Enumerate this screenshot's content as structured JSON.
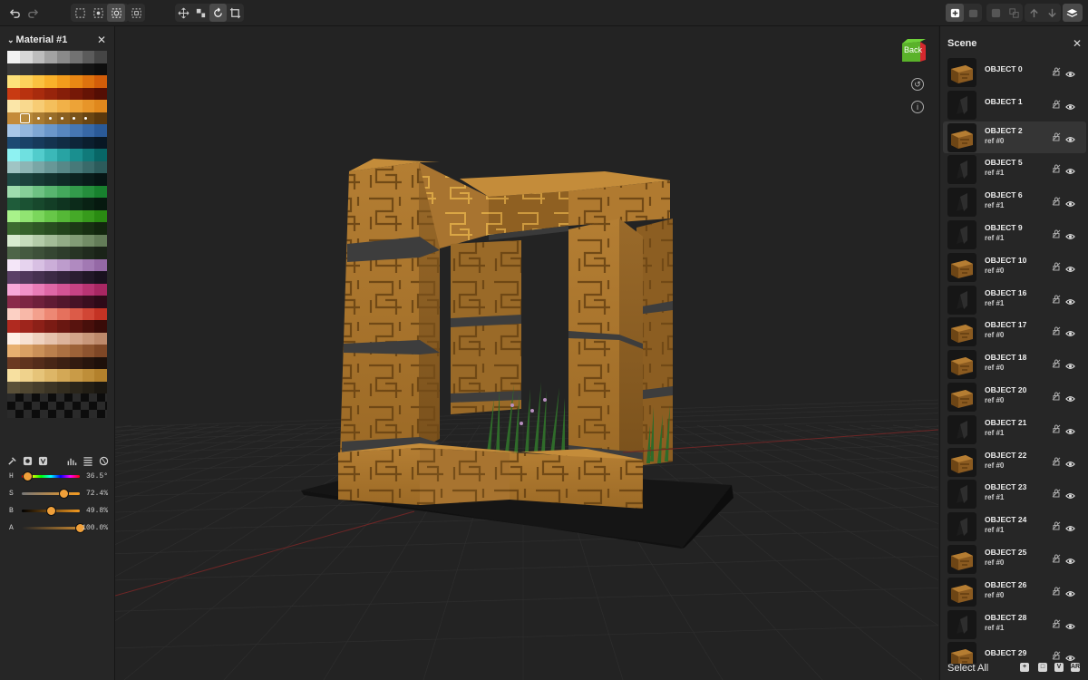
{
  "material_panel": {
    "title": "Material #1",
    "sliders": [
      {
        "label": "H",
        "value_text": "36.5°",
        "fraction": 0.1
      },
      {
        "label": "S",
        "value_text": "72.4%",
        "fraction": 0.724
      },
      {
        "label": "B",
        "value_text": "49.8%",
        "fraction": 0.498
      },
      {
        "label": "A",
        "value_text": "100.0%",
        "fraction": 1.0
      }
    ],
    "palette_rows": [
      [
        "#f2f2f2",
        "#d8d8d8",
        "#bdbdbd",
        "#a3a3a3",
        "#8a8a8a",
        "#727272",
        "#5b5b5b",
        "#454545"
      ],
      [
        "#3a3a3a",
        "#333333",
        "#2c2c2c",
        "#262626",
        "#202020",
        "#1a1a1a",
        "#141414",
        "#0e0e0e"
      ],
      [
        "#fde27a",
        "#fcd25c",
        "#fbc240",
        "#f9b12a",
        "#f39c1c",
        "#e98714",
        "#de720e",
        "#d25d09"
      ],
      [
        "#c83a12",
        "#b8320f",
        "#a82b0d",
        "#97240b",
        "#861e09",
        "#761807",
        "#651305",
        "#540e04"
      ],
      [
        "#fbe6a8",
        "#f9d98e",
        "#f7cc74",
        "#f4bf5c",
        "#f1b148",
        "#eda337",
        "#e79529",
        "#e0881d"
      ],
      [
        "sel",
        "#b88a3c",
        "#a97b32",
        "#996d29",
        "#895f21",
        "#79521a",
        "#694513",
        "#5a380d"
      ],
      [
        "#a8c7e8",
        "#93b7de",
        "#7ea7d4",
        "#6a97ca",
        "#5787bf",
        "#4677b3",
        "#3768a6",
        "#2a5a98"
      ],
      [
        "#1d4a73",
        "#1a4267",
        "#173a5b",
        "#14334f",
        "#112c44",
        "#0e2539",
        "#0b1e2e",
        "#081724"
      ],
      [
        "#8ef2f2",
        "#6fe0e0",
        "#52cccc",
        "#3bb8b8",
        "#28a3a3",
        "#1a8f8f",
        "#107a7a",
        "#086666"
      ],
      [
        "#a0c4c4",
        "#8db5b5",
        "#7aa6a6",
        "#689797",
        "#578888",
        "#477979",
        "#396a6a",
        "#2c5b5b"
      ],
      [
        "#1f4a45",
        "#1b423d",
        "#173a35",
        "#13322e",
        "#0f2a27",
        "#0c2320",
        "#091c1a",
        "#061514"
      ],
      [
        "#9fdcae",
        "#86cf98",
        "#6ec283",
        "#58b56f",
        "#44a85c",
        "#339b4b",
        "#258e3c",
        "#18812e"
      ],
      [
        "#1f5c3a",
        "#1b5233",
        "#17482c",
        "#133e26",
        "#0f3420",
        "#0c2b1a",
        "#092214",
        "#06190f"
      ],
      [
        "#a8f28a",
        "#91e472",
        "#7bd65c",
        "#67c748",
        "#55b837",
        "#45a928",
        "#379a1c",
        "#2a8b12"
      ],
      [
        "#3c6b30",
        "#35612a",
        "#2e5725",
        "#284d20",
        "#22431b",
        "#1c3916",
        "#172f12",
        "#12260e"
      ],
      [
        "#d8ecd0",
        "#c6dcbc",
        "#b4cca9",
        "#a3bc97",
        "#92ac86",
        "#829c76",
        "#728c66",
        "#637c58"
      ],
      [
        "#4d6548",
        "#455a40",
        "#3d5039",
        "#354632",
        "#2e3d2b",
        "#273424",
        "#202b1e",
        "#1a2318"
      ],
      [
        "#f4e6f8",
        "#e6d3ee",
        "#d8c0e3",
        "#cbaed8",
        "#bd9ccc",
        "#b08ac0",
        "#a279b3",
        "#9569a6"
      ],
      [
        "#5a3f66",
        "#50385b",
        "#463150",
        "#3c2a45",
        "#33233b",
        "#2a1d31",
        "#211727",
        "#19111e"
      ],
      [
        "#f7a8d8",
        "#f092c8",
        "#e87cb7",
        "#de67a6",
        "#d35495",
        "#c64384",
        "#b83473",
        "#a82763"
      ],
      [
        "#8a2a4a",
        "#7c2543",
        "#6e203b",
        "#601b34",
        "#53172d",
        "#461226",
        "#3a0e1f",
        "#2e0a18"
      ],
      [
        "#fcd0c4",
        "#f8b8a8",
        "#f3a08d",
        "#ed8874",
        "#e5715d",
        "#dc5b48",
        "#d14635",
        "#c43324"
      ],
      [
        "#b02a20",
        "#9e251c",
        "#8c2018",
        "#7a1b14",
        "#691711",
        "#58130e",
        "#480f0b",
        "#390b08"
      ],
      [
        "#fff0e6",
        "#f7e1d2",
        "#efd2bf",
        "#e6c3ad",
        "#ddb49b",
        "#d3a58a",
        "#c8977a",
        "#bd896b"
      ],
      [
        "#e8b070",
        "#d9a064",
        "#ca9058",
        "#bb804d",
        "#ac7142",
        "#9d6238",
        "#8e542f",
        "#7f4726"
      ],
      [
        "#6b3a22",
        "#5f331e",
        "#532c1a",
        "#472616",
        "#3c2013",
        "#311a10",
        "#27150d",
        "#1e100a"
      ],
      [
        "#f7e0a0",
        "#efd28c",
        "#e6c479",
        "#ddb667",
        "#d3a856",
        "#c99b47",
        "#be8e39",
        "#b3812c"
      ],
      [
        "#5a5038",
        "#504731",
        "#463e2b",
        "#3c3525",
        "#332d1f",
        "#2a251a",
        "#221e15",
        "#1a1711"
      ]
    ]
  },
  "scene_panel": {
    "title": "Scene",
    "footer_label": "Select All",
    "objects": [
      {
        "name": "OBJECT 0",
        "ref": "",
        "kind": "block",
        "selected": false
      },
      {
        "name": "OBJECT 1",
        "ref": "",
        "kind": "dark",
        "selected": false
      },
      {
        "name": "OBJECT 2",
        "ref": "ref #0",
        "kind": "block",
        "selected": true
      },
      {
        "name": "OBJECT 5",
        "ref": "ref #1",
        "kind": "dark",
        "selected": false
      },
      {
        "name": "OBJECT 6",
        "ref": "ref #1",
        "kind": "dark",
        "selected": false
      },
      {
        "name": "OBJECT 9",
        "ref": "ref #1",
        "kind": "dark",
        "selected": false
      },
      {
        "name": "OBJECT 10",
        "ref": "ref #0",
        "kind": "block",
        "selected": false
      },
      {
        "name": "OBJECT 16",
        "ref": "ref #1",
        "kind": "dark",
        "selected": false
      },
      {
        "name": "OBJECT 17",
        "ref": "ref #0",
        "kind": "block",
        "selected": false
      },
      {
        "name": "OBJECT 18",
        "ref": "ref #0",
        "kind": "block",
        "selected": false
      },
      {
        "name": "OBJECT 20",
        "ref": "ref #0",
        "kind": "block",
        "selected": false
      },
      {
        "name": "OBJECT 21",
        "ref": "ref #1",
        "kind": "dark",
        "selected": false
      },
      {
        "name": "OBJECT 22",
        "ref": "ref #0",
        "kind": "block",
        "selected": false
      },
      {
        "name": "OBJECT 23",
        "ref": "ref #1",
        "kind": "dark",
        "selected": false
      },
      {
        "name": "OBJECT 24",
        "ref": "ref #1",
        "kind": "dark",
        "selected": false
      },
      {
        "name": "OBJECT 25",
        "ref": "ref #0",
        "kind": "block",
        "selected": false
      },
      {
        "name": "OBJECT 26",
        "ref": "ref #0",
        "kind": "block",
        "selected": false
      },
      {
        "name": "OBJECT 28",
        "ref": "ref #1",
        "kind": "dark",
        "selected": false
      },
      {
        "name": "OBJECT 29",
        "ref": "",
        "kind": "block",
        "selected": false
      }
    ]
  },
  "viewport": {
    "nav_cube_label": "Back",
    "block_color": "#b07a30",
    "grid_color": "#2e2e2e",
    "axis_color": "#7a2a2a"
  },
  "toolbar": {
    "icons": [
      "undo-icon",
      "redo-icon",
      "select-box-icon",
      "select-lasso-icon",
      "select-face-icon",
      "focus-icon",
      "move-icon",
      "align-icon",
      "rotate-icon",
      "crop-icon",
      "add-icon",
      "delete-icon",
      "group-icon",
      "ungroup-icon",
      "up-icon",
      "down-icon",
      "layers-icon"
    ]
  }
}
